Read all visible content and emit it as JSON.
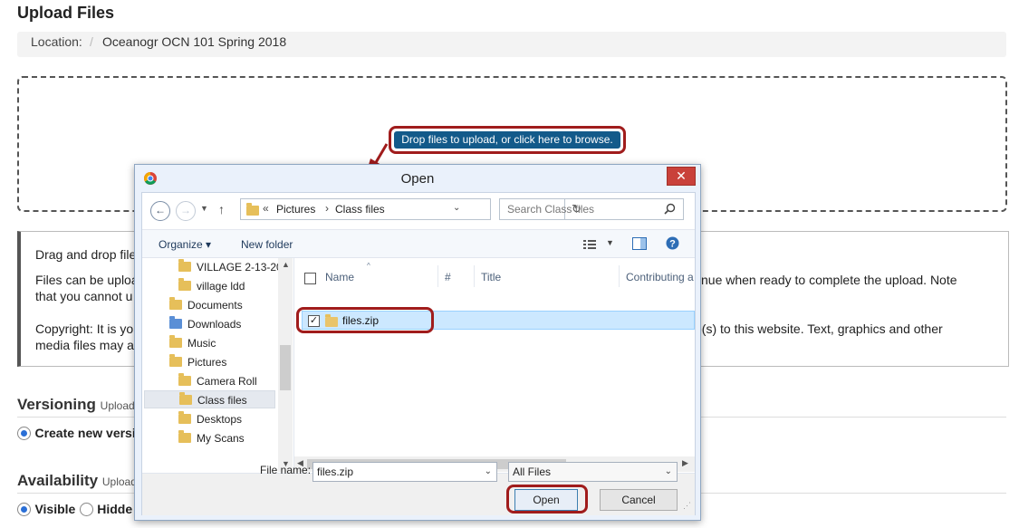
{
  "page": {
    "title": "Upload Files",
    "location_label": "Location:",
    "location_sep": "/",
    "location_value": "Oceanogr OCN 101 Spring 2018",
    "info": {
      "line1": "Drag and drop file",
      "line2a": "Files can be uploa",
      "line2b": "tinue when ready to complete the upload. Note",
      "line3": "that you cannot u",
      "line4a": "Copyright: It is yo",
      "line4b": "e(s) to this website. Text, graphics and other",
      "line5": "media files may a"
    },
    "versioning": {
      "heading": "Versioning",
      "sub": "Uploade",
      "option": "Create new versi"
    },
    "availability": {
      "heading": "Availability",
      "sub": "Uploade",
      "visible": "Visible",
      "hidden": "Hidde"
    }
  },
  "callout": {
    "text": "Drop files to upload, or click here to browse."
  },
  "dialog": {
    "title": "Open",
    "close": "✕",
    "breadcrumb": {
      "prefix": "«",
      "sep": "›",
      "parts": [
        "Pictures",
        "Class files"
      ]
    },
    "search_placeholder": "Search Class files",
    "organize": "Organize ▾",
    "new_folder": "New folder",
    "tree": [
      {
        "label": "VILLAGE 2-13-20",
        "type": "folder"
      },
      {
        "label": "village ldd",
        "type": "folder"
      },
      {
        "label": "Documents",
        "type": "lib"
      },
      {
        "label": "Downloads",
        "type": "lib"
      },
      {
        "label": "Music",
        "type": "lib"
      },
      {
        "label": "Pictures",
        "type": "lib"
      },
      {
        "label": "Camera Roll",
        "type": "folder"
      },
      {
        "label": "Class files",
        "type": "folder"
      },
      {
        "label": "Desktops",
        "type": "folder"
      },
      {
        "label": "My Scans",
        "type": "folder"
      }
    ],
    "columns": {
      "name": "Name",
      "num": "#",
      "title": "Title",
      "contrib": "Contributing a"
    },
    "file": {
      "name": "files.zip",
      "checked": true
    },
    "filename_label": "File name:",
    "filename_value": "files.zip",
    "filter_value": "All Files",
    "open_button": "Open",
    "cancel_button": "Cancel"
  },
  "colors": {
    "callout_bg": "#135a8a",
    "highlight": "#a01c1c",
    "selection": "#cce8ff"
  }
}
